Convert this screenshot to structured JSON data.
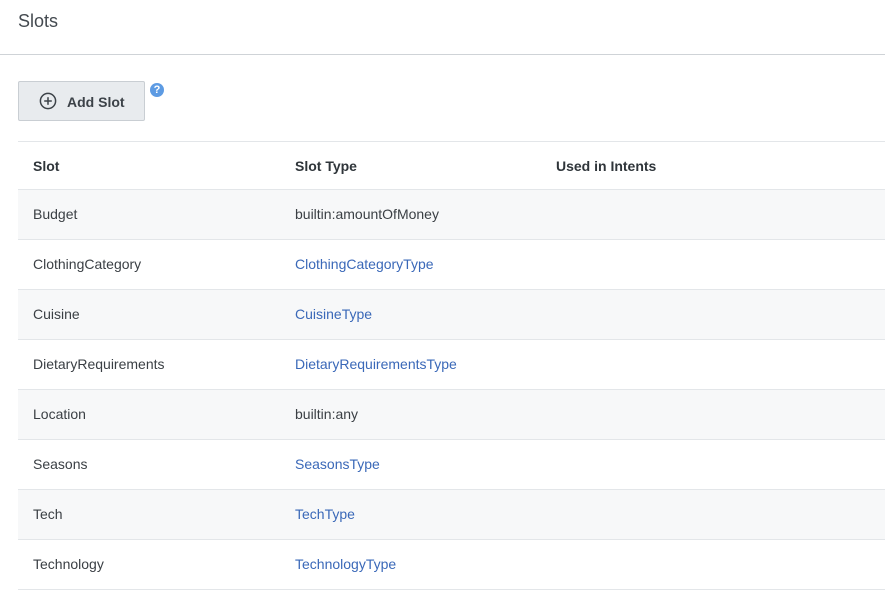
{
  "header": {
    "title": "Slots"
  },
  "toolbar": {
    "add_slot_label": "Add Slot",
    "help_glyph": "?",
    "add_icon": "plus-circle-icon",
    "help_icon": "question-circle-icon"
  },
  "table": {
    "columns": [
      "Slot",
      "Slot Type",
      "Used in Intents"
    ],
    "rows": [
      {
        "slot": "Budget",
        "slot_type": "builtin:amountOfMoney",
        "type_is_link": false,
        "used_in_intents": ""
      },
      {
        "slot": "ClothingCategory",
        "slot_type": "ClothingCategoryType",
        "type_is_link": true,
        "used_in_intents": ""
      },
      {
        "slot": "Cuisine",
        "slot_type": "CuisineType",
        "type_is_link": true,
        "used_in_intents": ""
      },
      {
        "slot": "DietaryRequirements",
        "slot_type": "DietaryRequirementsType",
        "type_is_link": true,
        "used_in_intents": ""
      },
      {
        "slot": "Location",
        "slot_type": "builtin:any",
        "type_is_link": false,
        "used_in_intents": ""
      },
      {
        "slot": "Seasons",
        "slot_type": "SeasonsType",
        "type_is_link": true,
        "used_in_intents": ""
      },
      {
        "slot": "Tech",
        "slot_type": "TechType",
        "type_is_link": true,
        "used_in_intents": ""
      },
      {
        "slot": "Technology",
        "slot_type": "TechnologyType",
        "type_is_link": true,
        "used_in_intents": ""
      }
    ]
  },
  "colors": {
    "link": "#3a68b8",
    "button_bg": "#e8ebee",
    "help_icon": "#5d9be3",
    "row_alt": "#f7f8f9"
  }
}
